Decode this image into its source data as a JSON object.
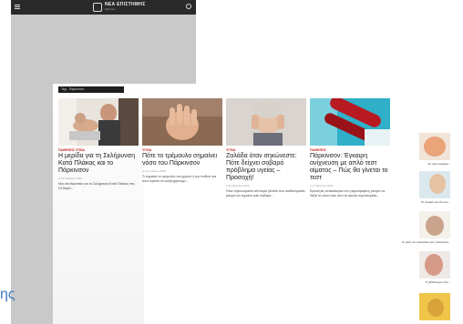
{
  "phone": {
    "site_title": "ΝΕΑ ΕΠΙΣΤΗΜΗΣ",
    "site_tagline": "Ειδήσεις"
  },
  "breadcrumb": "Tag - Πάρκινσον",
  "articles": [
    {
      "category": "ΠΑΘΗΣΕΙΣ   ΥΓΕΙΑ",
      "title": "Η μερίδα για τη Σκλήρυνση Κατά Πλάκας και το Πάρκινσον",
      "date": "● 23 Απριλίου 2020",
      "excerpt": "Μια νέα θεραπεία για το Σκλήρυνση Κατά Πλάκας στις 23 Απρίλ..."
    },
    {
      "category": "ΥΓΕΙΑ",
      "title": "Πότε το τρέμουλο σημαίνει νόσο του Πάρκινσον",
      "date": "● 12 Απριλίου 2020",
      "excerpt": "Τι σημαίνει το τρέμουλο του χεριού ή των ποδιών και πότε πρέπει να ανησυχήσουμε..."
    },
    {
      "category": "ΥΓΕΙΑ",
      "title": "Ζαλάδα όταν σηκώνεστε: Πότε δείχνει σοβαρό πρόβλημα υγείας – Προσοχή!",
      "date": "● 30 Μαρτίου 2020",
      "excerpt": "Όταν σηκωνόμαστε απότομα ζαλάδα που αισθανόμαστε μπορεί να σημαίνει κάτι σοβαρό..."
    },
    {
      "category": "ΠΑΘΗΣΕΙΣ",
      "title": "Πάρκινσον: Έγκαιρη ανίχνευση με απλό τεστ αίματος – Πώς θα γίνεται το τεστ",
      "date": "● 27 Μαρτίου 2020",
      "excerpt": "Ερευνητές ανακάλυψαν ότι η αιμοσφαιρίνη μπορεί να δείξει τη νόσο πριν από τα πρώτα συμπτώματα..."
    }
  ],
  "sidebar": [
    {
      "caption": "Σε ποιο ηλικιακό..."
    },
    {
      "caption": "Το προφίλ σας θα σας..."
    },
    {
      "caption": "Η υγεία του εγκεφάλου και η διατροφή..."
    },
    {
      "caption": "Τι μαθαίνουμε από..."
    },
    {
      "caption": "Οι χρήσεις του ελαιόλαδου για την υγεία"
    },
    {
      "caption": ""
    }
  ],
  "cut_text": "ης"
}
